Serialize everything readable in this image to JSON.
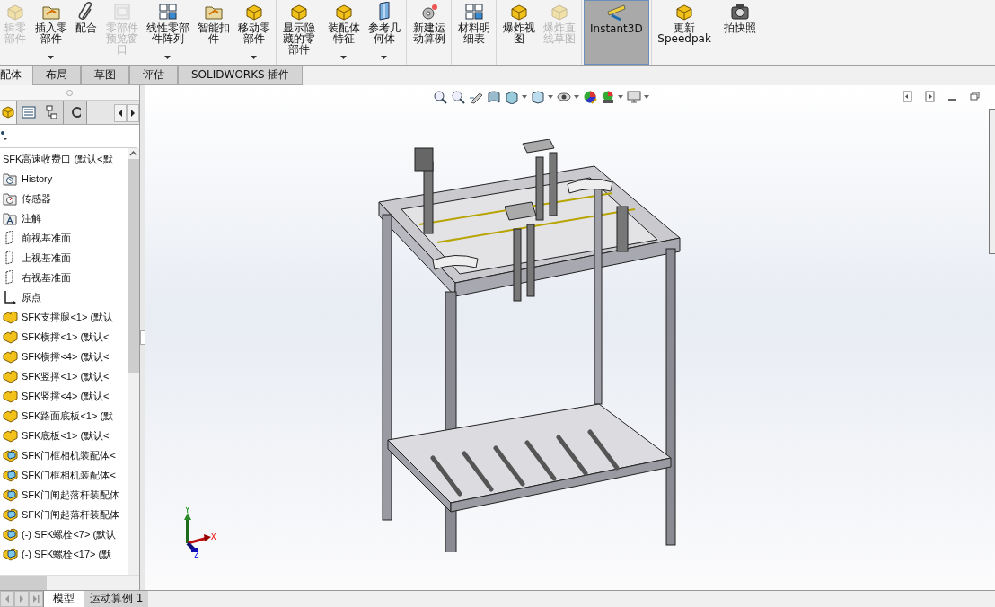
{
  "toolbar": {
    "items": [
      {
        "label": "辑零部件",
        "disabled": true,
        "dropdown": false,
        "selected": false,
        "separator_before": false
      },
      {
        "label": "插入零部件",
        "disabled": false,
        "dropdown": true,
        "selected": false,
        "separator_before": false
      },
      {
        "label": "配合",
        "disabled": false,
        "dropdown": false,
        "selected": false,
        "separator_before": false
      },
      {
        "label": "零部件预览窗口",
        "disabled": true,
        "dropdown": false,
        "selected": false,
        "separator_before": false
      },
      {
        "label": "线性零部件阵列",
        "disabled": false,
        "dropdown": true,
        "selected": false,
        "separator_before": false
      },
      {
        "label": "智能扣件",
        "disabled": false,
        "dropdown": false,
        "selected": false,
        "separator_before": false
      },
      {
        "label": "移动零部件",
        "disabled": false,
        "dropdown": true,
        "selected": false,
        "separator_before": false
      },
      {
        "label": "显示隐藏的零部件",
        "disabled": false,
        "dropdown": false,
        "selected": false,
        "separator_before": true
      },
      {
        "label": "装配体特征",
        "disabled": false,
        "dropdown": true,
        "selected": false,
        "separator_before": true
      },
      {
        "label": "参考几何体",
        "disabled": false,
        "dropdown": true,
        "selected": false,
        "separator_before": false
      },
      {
        "label": "新建运动算例",
        "disabled": false,
        "dropdown": false,
        "selected": false,
        "separator_before": true
      },
      {
        "label": "材料明细表",
        "disabled": false,
        "dropdown": false,
        "selected": false,
        "separator_before": true
      },
      {
        "label": "爆炸视图",
        "disabled": false,
        "dropdown": false,
        "selected": false,
        "separator_before": true
      },
      {
        "label": "爆炸直线草图",
        "disabled": true,
        "dropdown": false,
        "selected": false,
        "separator_before": false
      },
      {
        "label": "Instant3D",
        "disabled": false,
        "dropdown": false,
        "selected": true,
        "separator_before": true
      },
      {
        "label": "更新 Speedpak",
        "disabled": false,
        "dropdown": false,
        "selected": false,
        "separator_before": true
      },
      {
        "label": "拍快照",
        "disabled": false,
        "dropdown": false,
        "selected": false,
        "separator_before": true
      }
    ]
  },
  "command_tabs": [
    {
      "label": "配体",
      "selected": true
    },
    {
      "label": "布局",
      "selected": false
    },
    {
      "label": "草图",
      "selected": false
    },
    {
      "label": "评估",
      "selected": false
    },
    {
      "label": "SOLIDWORKS 插件",
      "selected": false
    }
  ],
  "feature_tree": {
    "root": "SFK高速收费口  (默认<默",
    "items": [
      {
        "kind": "history",
        "label": "History"
      },
      {
        "kind": "sensor",
        "label": "传感器"
      },
      {
        "kind": "annotation",
        "label": "注解"
      },
      {
        "kind": "plane",
        "label": "前视基准面"
      },
      {
        "kind": "plane",
        "label": "上视基准面"
      },
      {
        "kind": "plane",
        "label": "右视基准面"
      },
      {
        "kind": "origin",
        "label": "原点"
      },
      {
        "kind": "part",
        "label": "SFK支撑腿<1> (默认"
      },
      {
        "kind": "part",
        "label": "SFK横撑<1> (默认<"
      },
      {
        "kind": "part",
        "label": "SFK横撑<4> (默认<"
      },
      {
        "kind": "part",
        "label": "SFK竖撑<1> (默认<"
      },
      {
        "kind": "part",
        "label": "SFK竖撑<4> (默认<"
      },
      {
        "kind": "part",
        "label": "SFK路面底板<1> (默"
      },
      {
        "kind": "part",
        "label": "SFK底板<1> (默认<"
      },
      {
        "kind": "assembly",
        "label": "SFK门框相机装配体<"
      },
      {
        "kind": "assembly",
        "label": "SFK门框相机装配体<"
      },
      {
        "kind": "assembly",
        "label": "SFK门闸起落杆装配体"
      },
      {
        "kind": "assembly",
        "label": "SFK门闸起落杆装配体"
      },
      {
        "kind": "assembly",
        "label": "(-) SFK螺栓<7> (默认"
      },
      {
        "kind": "assembly",
        "label": "(-) SFK螺栓<17> (默"
      }
    ]
  },
  "triad": {
    "x": "X",
    "y": "Y",
    "z": "Z"
  },
  "bottom_tabs": [
    {
      "label": "模型",
      "selected": true
    },
    {
      "label": "运动算例 1",
      "selected": false
    }
  ]
}
